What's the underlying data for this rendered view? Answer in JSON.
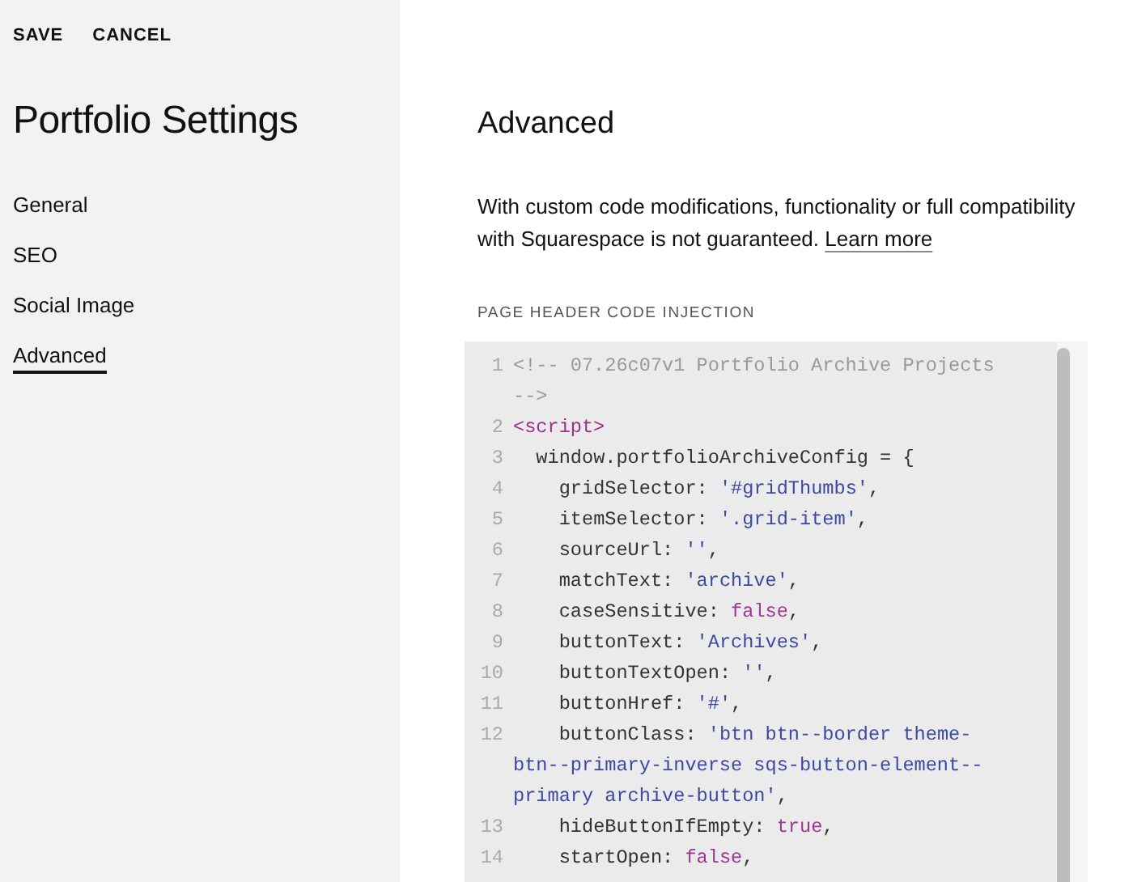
{
  "toolbar": {
    "actions": [
      "SAVE",
      "CANCEL"
    ]
  },
  "sidebar": {
    "title": "Portfolio Settings",
    "items": [
      {
        "label": "General",
        "selected": false
      },
      {
        "label": "SEO",
        "selected": false
      },
      {
        "label": "Social Image",
        "selected": false
      },
      {
        "label": "Advanced",
        "selected": true
      }
    ]
  },
  "main": {
    "heading": "Advanced",
    "description": "With custom code modifications, functionality or full compatibility with Squarespace is not guaranteed.",
    "link": "Learn more",
    "field_label": "PAGE HEADER CODE INJECTION",
    "code_lines": [
      {
        "number": "1",
        "tokens": [
          {
            "kind": "comment",
            "text": "<!-- 07.26c07v1 Portfolio Archive Projects -->"
          }
        ]
      },
      {
        "number": "2",
        "tokens": [
          {
            "kind": "tag",
            "text": "<script>"
          }
        ]
      },
      {
        "number": "3",
        "tokens": [
          {
            "kind": "plain",
            "text": "  window.portfolioArchiveConfig = {"
          }
        ]
      },
      {
        "number": "4",
        "tokens": [
          {
            "kind": "plain",
            "text": "    gridSelector: "
          },
          {
            "kind": "string",
            "text": "'#gridThumbs'"
          },
          {
            "kind": "plain",
            "text": ","
          }
        ]
      },
      {
        "number": "5",
        "tokens": [
          {
            "kind": "plain",
            "text": "    itemSelector: "
          },
          {
            "kind": "string",
            "text": "'.grid-item'"
          },
          {
            "kind": "plain",
            "text": ","
          }
        ]
      },
      {
        "number": "6",
        "tokens": [
          {
            "kind": "plain",
            "text": "    sourceUrl: "
          },
          {
            "kind": "string",
            "text": "''"
          },
          {
            "kind": "plain",
            "text": ","
          }
        ]
      },
      {
        "number": "7",
        "tokens": [
          {
            "kind": "plain",
            "text": "    matchText: "
          },
          {
            "kind": "string",
            "text": "'archive'"
          },
          {
            "kind": "plain",
            "text": ","
          }
        ]
      },
      {
        "number": "8",
        "tokens": [
          {
            "kind": "plain",
            "text": "    caseSensitive: "
          },
          {
            "kind": "atom",
            "text": "false"
          },
          {
            "kind": "plain",
            "text": ","
          }
        ]
      },
      {
        "number": "9",
        "tokens": [
          {
            "kind": "plain",
            "text": "    buttonText: "
          },
          {
            "kind": "string",
            "text": "'Archives'"
          },
          {
            "kind": "plain",
            "text": ","
          }
        ]
      },
      {
        "number": "10",
        "tokens": [
          {
            "kind": "plain",
            "text": "    buttonTextOpen: "
          },
          {
            "kind": "string",
            "text": "''"
          },
          {
            "kind": "plain",
            "text": ","
          }
        ]
      },
      {
        "number": "11",
        "tokens": [
          {
            "kind": "plain",
            "text": "    buttonHref: "
          },
          {
            "kind": "string",
            "text": "'#'"
          },
          {
            "kind": "plain",
            "text": ","
          }
        ]
      },
      {
        "number": "12",
        "tokens": [
          {
            "kind": "plain",
            "text": "    buttonClass: "
          },
          {
            "kind": "string",
            "text": "'btn btn--border theme-btn--primary-inverse sqs-button-element--primary archive-button'"
          },
          {
            "kind": "plain",
            "text": ","
          }
        ]
      },
      {
        "number": "13",
        "tokens": [
          {
            "kind": "plain",
            "text": "    hideButtonIfEmpty: "
          },
          {
            "kind": "atom",
            "text": "true"
          },
          {
            "kind": "plain",
            "text": ","
          }
        ]
      },
      {
        "number": "14",
        "tokens": [
          {
            "kind": "plain",
            "text": "    startOpen: "
          },
          {
            "kind": "atom",
            "text": "false"
          },
          {
            "kind": "plain",
            "text": ","
          }
        ]
      }
    ]
  }
}
